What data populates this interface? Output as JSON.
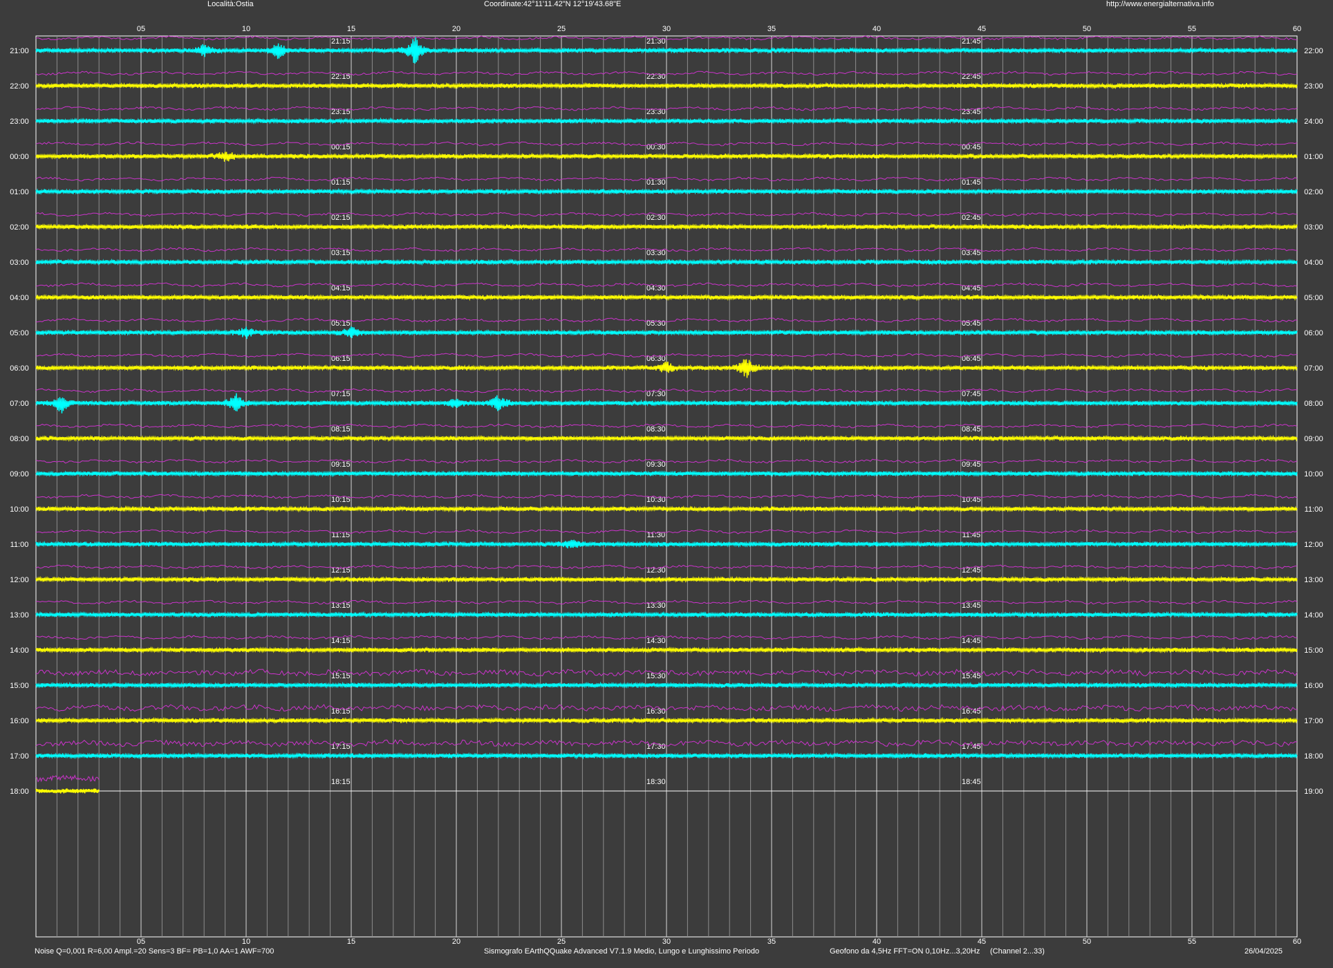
{
  "header": {
    "location": "Località:Ostia",
    "coordinates": "Coordinate:42°11'11.42\"N  12°19'43.68\"E",
    "url": "http://www.energialternativa.info"
  },
  "footer": {
    "params": "Noise Q=0,001 R=6,00 Ampl.=20 Sens=3 BF= PB=1,0 AA=1 AWF=700",
    "software": "Sismografo  EArthQQuake Advanced V7.1.9  Medio, Lungo e Lunghissimo Periodo",
    "sensor": "Geofono da 4,5Hz FFT=ON 0,10Hz...3,20Hz",
    "channel": "(Channel 2...33)",
    "date": "26/04/2025"
  },
  "chart_data": {
    "type": "line",
    "xlabel": "",
    "ylabel": "",
    "xlim": [
      0,
      60
    ],
    "x_ticks": [
      "05",
      "10",
      "15",
      "20",
      "25",
      "30",
      "35",
      "40",
      "45",
      "50",
      "55",
      "60"
    ],
    "grid": true,
    "rows_left_labels": [
      "21:00",
      "22:00",
      "23:00",
      "00:00",
      "01:00",
      "02:00",
      "03:00",
      "04:00",
      "05:00",
      "06:00",
      "07:00",
      "08:00",
      "09:00",
      "10:00",
      "11:00",
      "12:00",
      "13:00",
      "14:00",
      "15:00",
      "16:00",
      "17:00",
      "18:00"
    ],
    "rows_right_labels": [
      "22:00",
      "23:00",
      "24:00",
      "01:00",
      "02:00",
      "03:00",
      "04:00",
      "05:00",
      "06:00",
      "07:00",
      "08:00",
      "09:00",
      "10:00",
      "11:00",
      "12:00",
      "13:00",
      "14:00",
      "15:00",
      "16:00",
      "17:00",
      "18:00",
      "19:00"
    ],
    "quarter_labels": [
      [
        "21:15",
        "21:30",
        "21:45"
      ],
      [
        "22:15",
        "22:30",
        "22:45"
      ],
      [
        "23:15",
        "23:30",
        "23:45"
      ],
      [
        "00:15",
        "00:30",
        "00:45"
      ],
      [
        "01:15",
        "01:30",
        "01:45"
      ],
      [
        "02:15",
        "02:30",
        "02:45"
      ],
      [
        "03:15",
        "03:30",
        "03:45"
      ],
      [
        "04:15",
        "04:30",
        "04:45"
      ],
      [
        "05:15",
        "05:30",
        "05:45"
      ],
      [
        "06:15",
        "06:30",
        "06:45"
      ],
      [
        "07:15",
        "07:30",
        "07:45"
      ],
      [
        "08:15",
        "08:30",
        "08:45"
      ],
      [
        "09:15",
        "09:30",
        "09:45"
      ],
      [
        "10:15",
        "10:30",
        "10:45"
      ],
      [
        "11:15",
        "11:30",
        "11:45"
      ],
      [
        "12:15",
        "12:30",
        "12:45"
      ],
      [
        "13:15",
        "13:30",
        "13:45"
      ],
      [
        "14:15",
        "14:30",
        "14:45"
      ],
      [
        "15:15",
        "15:30",
        "15:45"
      ],
      [
        "16:15",
        "16:30",
        "16:45"
      ],
      [
        "17:15",
        "17:30",
        "17:45"
      ],
      [
        "18:15",
        "18:30",
        "18:45"
      ]
    ],
    "quarter_minutes": [
      14.5,
      29.5,
      44.5
    ],
    "trace_colors": [
      "#00ffff",
      "#ffff00"
    ],
    "overlay_color": "#cc33cc",
    "last_row_end_minute": 3,
    "events": [
      {
        "row": 0,
        "minute": 18.0,
        "amp": 22
      },
      {
        "row": 0,
        "minute": 11.5,
        "amp": 12
      },
      {
        "row": 0,
        "minute": 8.0,
        "amp": 8
      },
      {
        "row": 3,
        "minute": 9.0,
        "amp": 8
      },
      {
        "row": 8,
        "minute": 15.0,
        "amp": 9
      },
      {
        "row": 8,
        "minute": 10.0,
        "amp": 8
      },
      {
        "row": 9,
        "minute": 33.8,
        "amp": 16
      },
      {
        "row": 9,
        "minute": 30.0,
        "amp": 8
      },
      {
        "row": 10,
        "minute": 1.2,
        "amp": 14
      },
      {
        "row": 10,
        "minute": 9.5,
        "amp": 13
      },
      {
        "row": 10,
        "minute": 22.0,
        "amp": 12
      },
      {
        "row": 10,
        "minute": 20.0,
        "amp": 8
      },
      {
        "row": 14,
        "minute": 25.5,
        "amp": 7
      }
    ]
  }
}
